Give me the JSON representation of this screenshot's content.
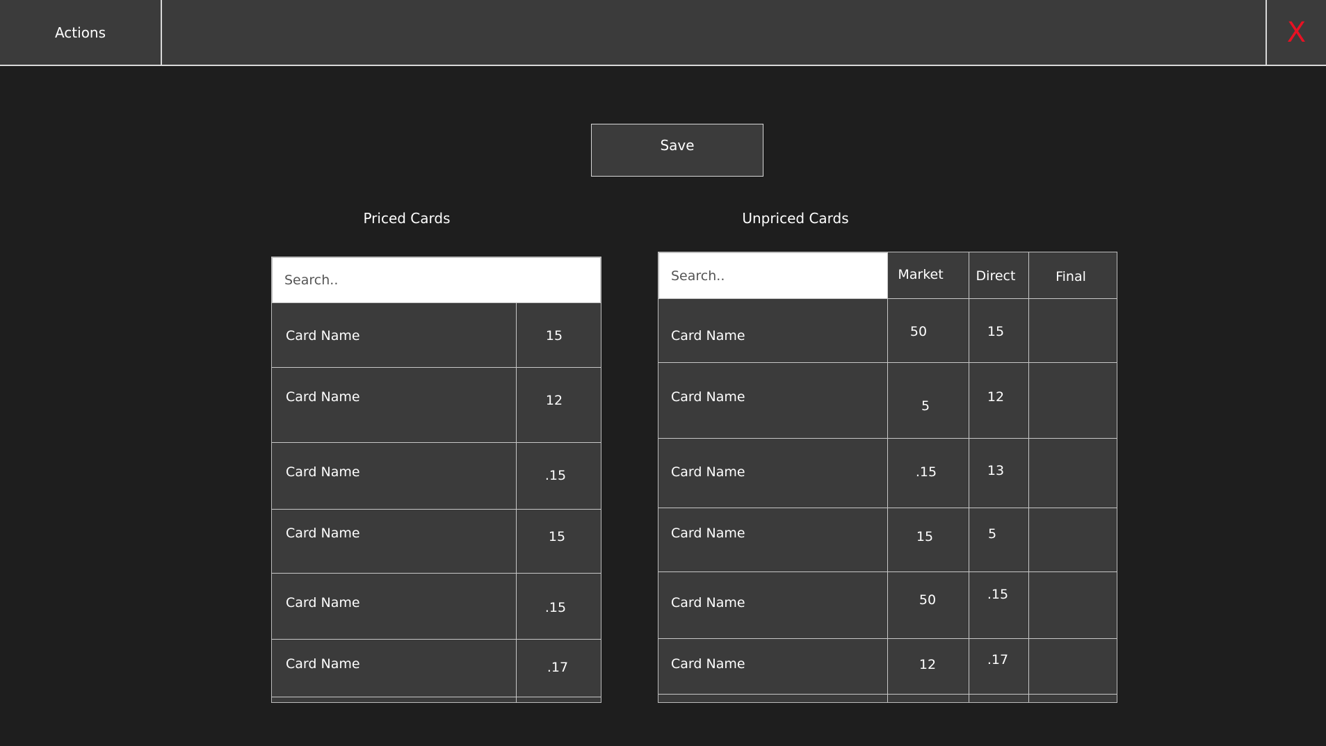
{
  "header": {
    "actions_label": "Actions",
    "close_label": "X"
  },
  "toolbar": {
    "save_label": "Save"
  },
  "priced": {
    "title": "Priced Cards",
    "search_placeholder": "Search..",
    "rows": [
      {
        "name": "Card Name",
        "price": "15"
      },
      {
        "name": "Card Name",
        "price": "12"
      },
      {
        "name": "Card Name",
        "price": ".15"
      },
      {
        "name": "Card Name",
        "price": "15"
      },
      {
        "name": "Card Name",
        "price": ".15"
      },
      {
        "name": "Card Name",
        "price": ".17"
      }
    ]
  },
  "unpriced": {
    "title": "Unpriced Cards",
    "search_placeholder": "Search..",
    "columns": {
      "market": "Market",
      "direct": "Direct",
      "final": "Final"
    },
    "rows": [
      {
        "name": "Card Name",
        "market": "50",
        "direct": "15",
        "final": ""
      },
      {
        "name": "Card Name",
        "market": "5",
        "direct": "12",
        "final": ""
      },
      {
        "name": "Card Name",
        "market": ".15",
        "direct": "13",
        "final": ""
      },
      {
        "name": "Card Name",
        "market": "15",
        "direct": "5",
        "final": ""
      },
      {
        "name": "Card Name",
        "market": "50",
        "direct": ".15",
        "final": ""
      },
      {
        "name": "Card Name",
        "market": "12",
        "direct": ".17",
        "final": ""
      }
    ]
  },
  "colors": {
    "background": "#1e1e1e",
    "panel": "#3b3b3b",
    "close_accent": "#e81123"
  }
}
